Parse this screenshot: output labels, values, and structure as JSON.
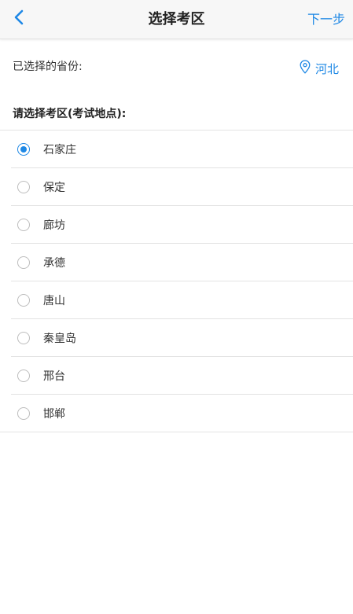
{
  "navbar": {
    "title": "选择考区",
    "next_label": "下一步",
    "back_icon": "chevron-left-icon"
  },
  "province": {
    "label": "已选择的省份:",
    "value": "河北",
    "icon": "location-pin-icon"
  },
  "section": {
    "title": "请选择考区(考试地点):"
  },
  "areas": [
    {
      "label": "石家庄",
      "selected": true
    },
    {
      "label": "保定",
      "selected": false
    },
    {
      "label": "廊坊",
      "selected": false
    },
    {
      "label": "承德",
      "selected": false
    },
    {
      "label": "唐山",
      "selected": false
    },
    {
      "label": "秦皇岛",
      "selected": false
    },
    {
      "label": "邢台",
      "selected": false
    },
    {
      "label": "邯郸",
      "selected": false
    }
  ],
  "colors": {
    "accent": "#1e88e5",
    "navbar_bg": "#f7f7f7",
    "divider": "#e3e3e3"
  }
}
